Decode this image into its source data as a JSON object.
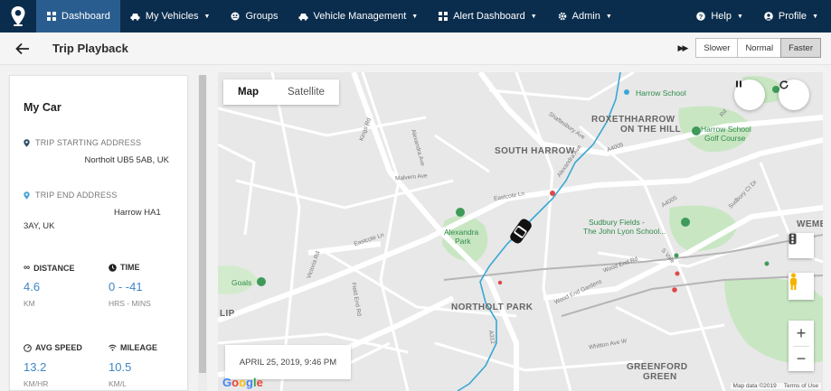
{
  "nav": {
    "items": [
      {
        "label": "Dashboard",
        "icon": "dashboard-icon",
        "caret": false,
        "active": true
      },
      {
        "label": "My Vehicles",
        "icon": "car-icon",
        "caret": true,
        "active": false
      },
      {
        "label": "Groups",
        "icon": "groups-icon",
        "caret": false,
        "active": false
      },
      {
        "label": "Vehicle Management",
        "icon": "car-icon",
        "caret": true,
        "active": false
      },
      {
        "label": "Alert Dashboard",
        "icon": "grid-icon",
        "caret": true,
        "active": false
      },
      {
        "label": "Admin",
        "icon": "gear-icon",
        "caret": true,
        "active": false
      }
    ],
    "help_label": "Help",
    "profile_label": "Profile",
    "accent": "#2a5d8f",
    "background": "#0b2d4d"
  },
  "page": {
    "title": "Trip Playback"
  },
  "speed": {
    "options": [
      "Slower",
      "Normal",
      "Faster"
    ],
    "selected": "Faster"
  },
  "trip": {
    "car_name": "My Car",
    "start_label": "TRIP STARTING ADDRESS",
    "start_address": "Northolt UB5 5AB, UK",
    "end_label": "TRIP END ADDRESS",
    "end_address_line1": "Harrow HA1",
    "end_address_line2": "3AY, UK",
    "distance_label": "DISTANCE",
    "distance_value": "4.6",
    "distance_unit": "KM",
    "time_label": "TIME",
    "time_value": "0 - -41",
    "time_unit": "HRS - MINS",
    "avg_speed_label": "AVG SPEED",
    "avg_speed_value": "13.2",
    "avg_speed_unit": "KM/HR",
    "mileage_label": "MILEAGE",
    "mileage_value": "10.5",
    "mileage_unit": "KM/L",
    "value_color": "#3d86c6"
  },
  "map": {
    "tab_map": "Map",
    "tab_satellite": "Satellite",
    "selected_tab": "Map",
    "date_time": "APRIL 25, 2019, 9:46 PM",
    "route_color": "#3aa7d4",
    "labels": {
      "south_harrow": "SOUTH HARROW",
      "roxeth": "ROXETH",
      "harrow_on_the_hill_1": "HARROW",
      "harrow_on_the_hill_2": "ON THE HILL",
      "northolt_park": "NORTHOLT PARK",
      "greenford_green_1": "GREENFORD",
      "greenford_green_2": "GREEN",
      "wemb": "WEMB",
      "lip": "LIP",
      "harrow_school": "Harrow School",
      "harrow_golf_1": "Harrow School",
      "harrow_golf_2": "Golf Course",
      "alexandra_park_1": "Alexandra",
      "alexandra_park_2": "Park",
      "sudbury_1": "Sudbury Fields -",
      "sudbury_2": "The John Lyon School...",
      "goals": "Goals"
    },
    "streets": [
      "Kings Rd",
      "Alexandra Ave",
      "Malvern Ave",
      "Eastcote Ln",
      "Victoria Rd",
      "Field End Rd",
      "Wood End Rd",
      "Wood End Gardens",
      "Whitton Ave W",
      "Eastcote Ln",
      "Shaftesbury Ave",
      "Sudbury Ct Dr",
      "A4005",
      "A4005",
      "A312",
      "Alexandra Ave",
      "S Vale",
      "Rd"
    ],
    "attribution_data": "Map data ©2019",
    "attribution_terms": "Terms of Use",
    "google_logo": "Google"
  }
}
